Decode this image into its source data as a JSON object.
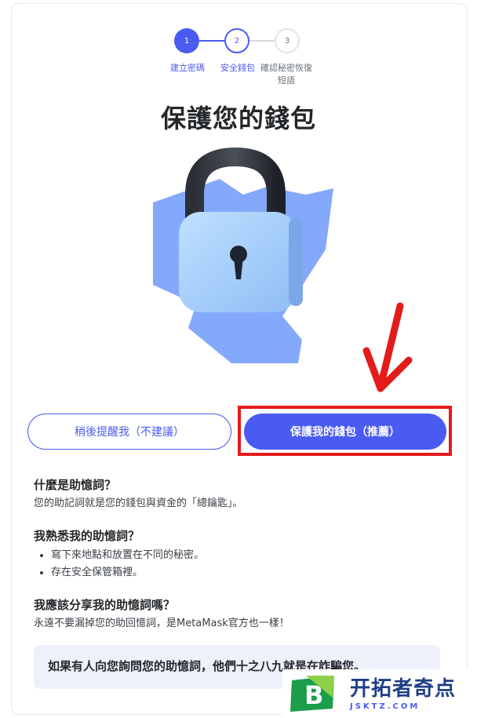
{
  "stepper": {
    "steps": [
      {
        "number": "1",
        "label": "建立密碼"
      },
      {
        "number": "2",
        "label": "安全錢包"
      },
      {
        "number": "3",
        "label": "確認秘密恢復短語"
      }
    ]
  },
  "page": {
    "title": "保護您的錢包"
  },
  "buttons": {
    "remind_later": "稍後提醒我（不建議）",
    "secure_wallet": "保護我的錢包（推薦）"
  },
  "faq": [
    {
      "question": "什麼是助憶詞？",
      "answer": "您的助記詞就是您的錢包與資金的「總鑰匙」。"
    },
    {
      "question": "我熟悉我的助憶詞？",
      "bullets": [
        "寫下來地點和放置在不同的秘密。",
        "存在安全保管箱裡。"
      ]
    },
    {
      "question": "我應該分享我的助憶詞嗎？",
      "answer": "永遠不要漏掉您的助回憶詞，是MetaMask官方也一樣！"
    }
  ],
  "warning": "如果有人向您詢問您的助憶詞，他們十之八九就是在詐騙您。",
  "watermark": {
    "title": "开拓者奇点",
    "url": "JSKTZ.COM"
  },
  "colors": {
    "primary": "#4a5bf2",
    "highlight_red": "#e31b1b",
    "warning_bg": "#eef0fb"
  }
}
